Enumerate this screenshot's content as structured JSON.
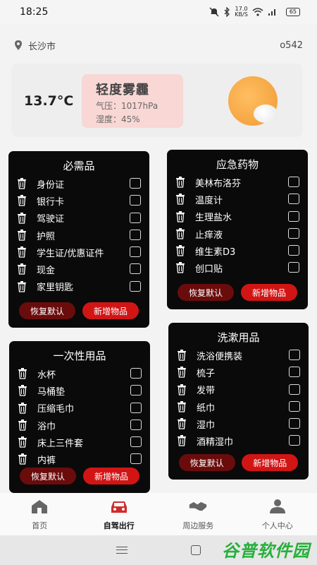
{
  "status_bar": {
    "time": "18:25",
    "speed": "17.0",
    "speed_unit": "KB/S",
    "battery": "65"
  },
  "location": {
    "city": "长沙市",
    "aqi": "o542"
  },
  "weather": {
    "temperature": "13.7°C",
    "condition": "轻度雾霾",
    "pressure": "气压：1017hPa",
    "humidity": "湿度：45%"
  },
  "cards": {
    "essentials": {
      "title": "必需品",
      "items": [
        "身份证",
        "银行卡",
        "驾驶证",
        "护照",
        "学生证/优惠证件",
        "现金",
        "家里钥匙"
      ],
      "reset": "恢复默认",
      "add": "新增物品"
    },
    "medicine": {
      "title": "应急药物",
      "items": [
        "美林布洛芬",
        "温度计",
        "生理盐水",
        "止痒液",
        "维生素D3",
        "创口贴"
      ],
      "reset": "恢复默认",
      "add": "新增物品"
    },
    "disposables": {
      "title": "一次性用品",
      "items": [
        "水杯",
        "马桶垫",
        "压缩毛巾",
        "浴巾",
        "床上三件套",
        "内裤"
      ],
      "reset": "恢复默认",
      "add": "新增物品"
    },
    "toiletries": {
      "title": "洗漱用品",
      "items": [
        "洗浴便携装",
        "梳子",
        "发带",
        "纸巾",
        "湿巾",
        "酒精湿巾"
      ],
      "reset": "恢复默认",
      "add": "新增物品"
    }
  },
  "nav": [
    {
      "label": "首页",
      "icon": "home-icon"
    },
    {
      "label": "自驾出行",
      "icon": "car-icon",
      "active": true
    },
    {
      "label": "周边服务",
      "icon": "handshake-icon"
    },
    {
      "label": "个人中心",
      "icon": "person-icon"
    }
  ],
  "watermark": "谷普软件园",
  "colors": {
    "card_bg": "#0a0a0a",
    "reset_btn": "#6b0c0c",
    "add_btn": "#d11515",
    "accent": "#d22a2a"
  }
}
